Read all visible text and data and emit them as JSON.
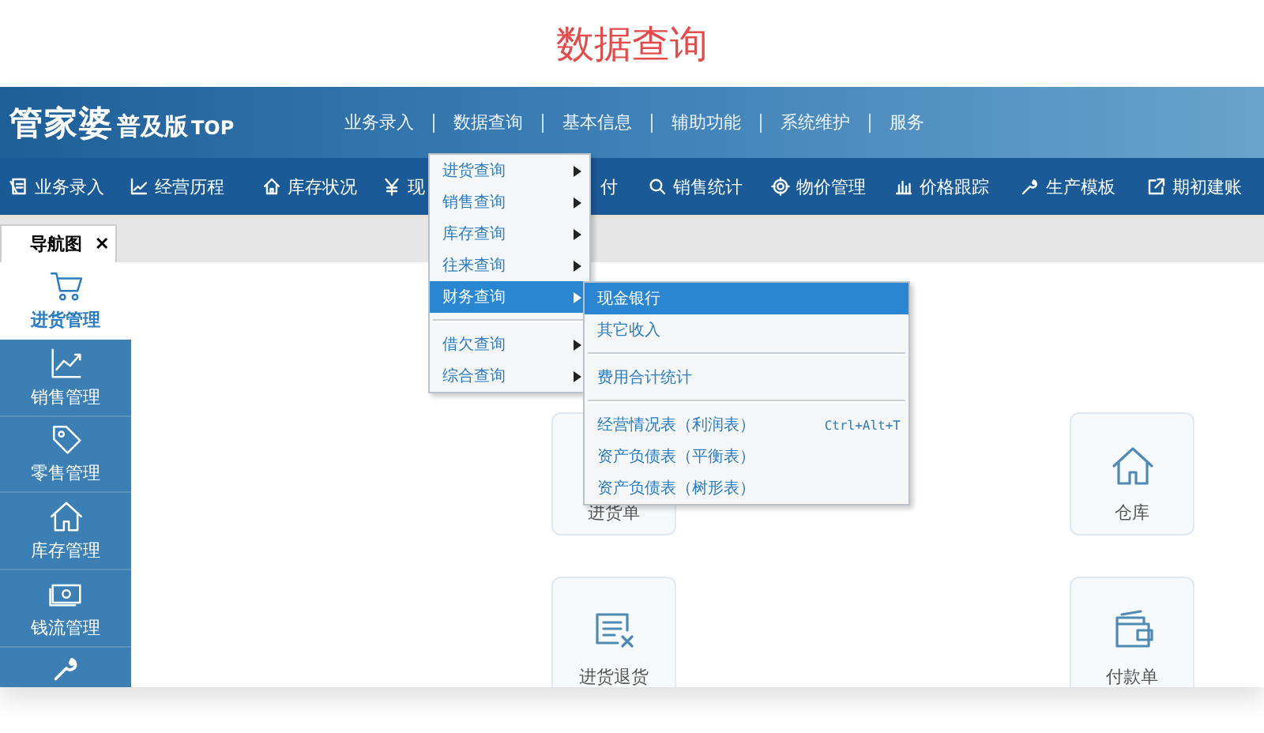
{
  "page_title": "数据查询",
  "logo": {
    "name": "管家婆",
    "edition": "普及版",
    "suffix": "TOP"
  },
  "top_menu": [
    {
      "label": "业务录入"
    },
    {
      "label": "数据查询"
    },
    {
      "label": "基本信息"
    },
    {
      "label": "辅助功能"
    },
    {
      "label": "系统维护"
    },
    {
      "label": "服务"
    }
  ],
  "toolbar": [
    {
      "label": "业务录入"
    },
    {
      "label": "经营历程"
    },
    {
      "label": "库存状况"
    },
    {
      "label": "现"
    },
    {
      "label": "付"
    },
    {
      "label": "销售统计"
    },
    {
      "label": "物价管理"
    },
    {
      "label": "价格跟踪"
    },
    {
      "label": "生产模板"
    },
    {
      "label": "期初建账"
    }
  ],
  "tab": {
    "label": "导航图",
    "close": "✕"
  },
  "sidebar": {
    "items": [
      {
        "label": "进货管理",
        "selected": true
      },
      {
        "label": "销售管理",
        "selected": false
      },
      {
        "label": "零售管理",
        "selected": false
      },
      {
        "label": "库存管理",
        "selected": false
      },
      {
        "label": "钱流管理",
        "selected": false
      }
    ]
  },
  "cards": [
    {
      "label": "进货单"
    },
    {
      "label": "仓库"
    },
    {
      "label": "进货退货"
    },
    {
      "label": "付款单"
    }
  ],
  "dropdown": {
    "groups": [
      [
        {
          "label": "进货查询",
          "selected": false
        },
        {
          "label": "销售查询",
          "selected": false
        },
        {
          "label": "库存查询",
          "selected": false
        },
        {
          "label": "往来查询",
          "selected": false
        },
        {
          "label": "财务查询",
          "selected": true
        }
      ],
      [
        {
          "label": "借欠查询",
          "selected": false
        },
        {
          "label": "综合查询",
          "selected": false
        }
      ]
    ]
  },
  "submenu": {
    "groups": [
      [
        {
          "label": "现金银行",
          "selected": true
        },
        {
          "label": "其它收入",
          "selected": false
        }
      ],
      [
        {
          "label": "费用合计统计",
          "selected": false
        }
      ],
      [
        {
          "label": "经营情况表（利润表）",
          "shortcut": "Ctrl+Alt+T",
          "selected": false
        },
        {
          "label": "资产负债表（平衡表）",
          "selected": false
        },
        {
          "label": "资产负债表（树形表）",
          "selected": false
        }
      ]
    ]
  }
}
